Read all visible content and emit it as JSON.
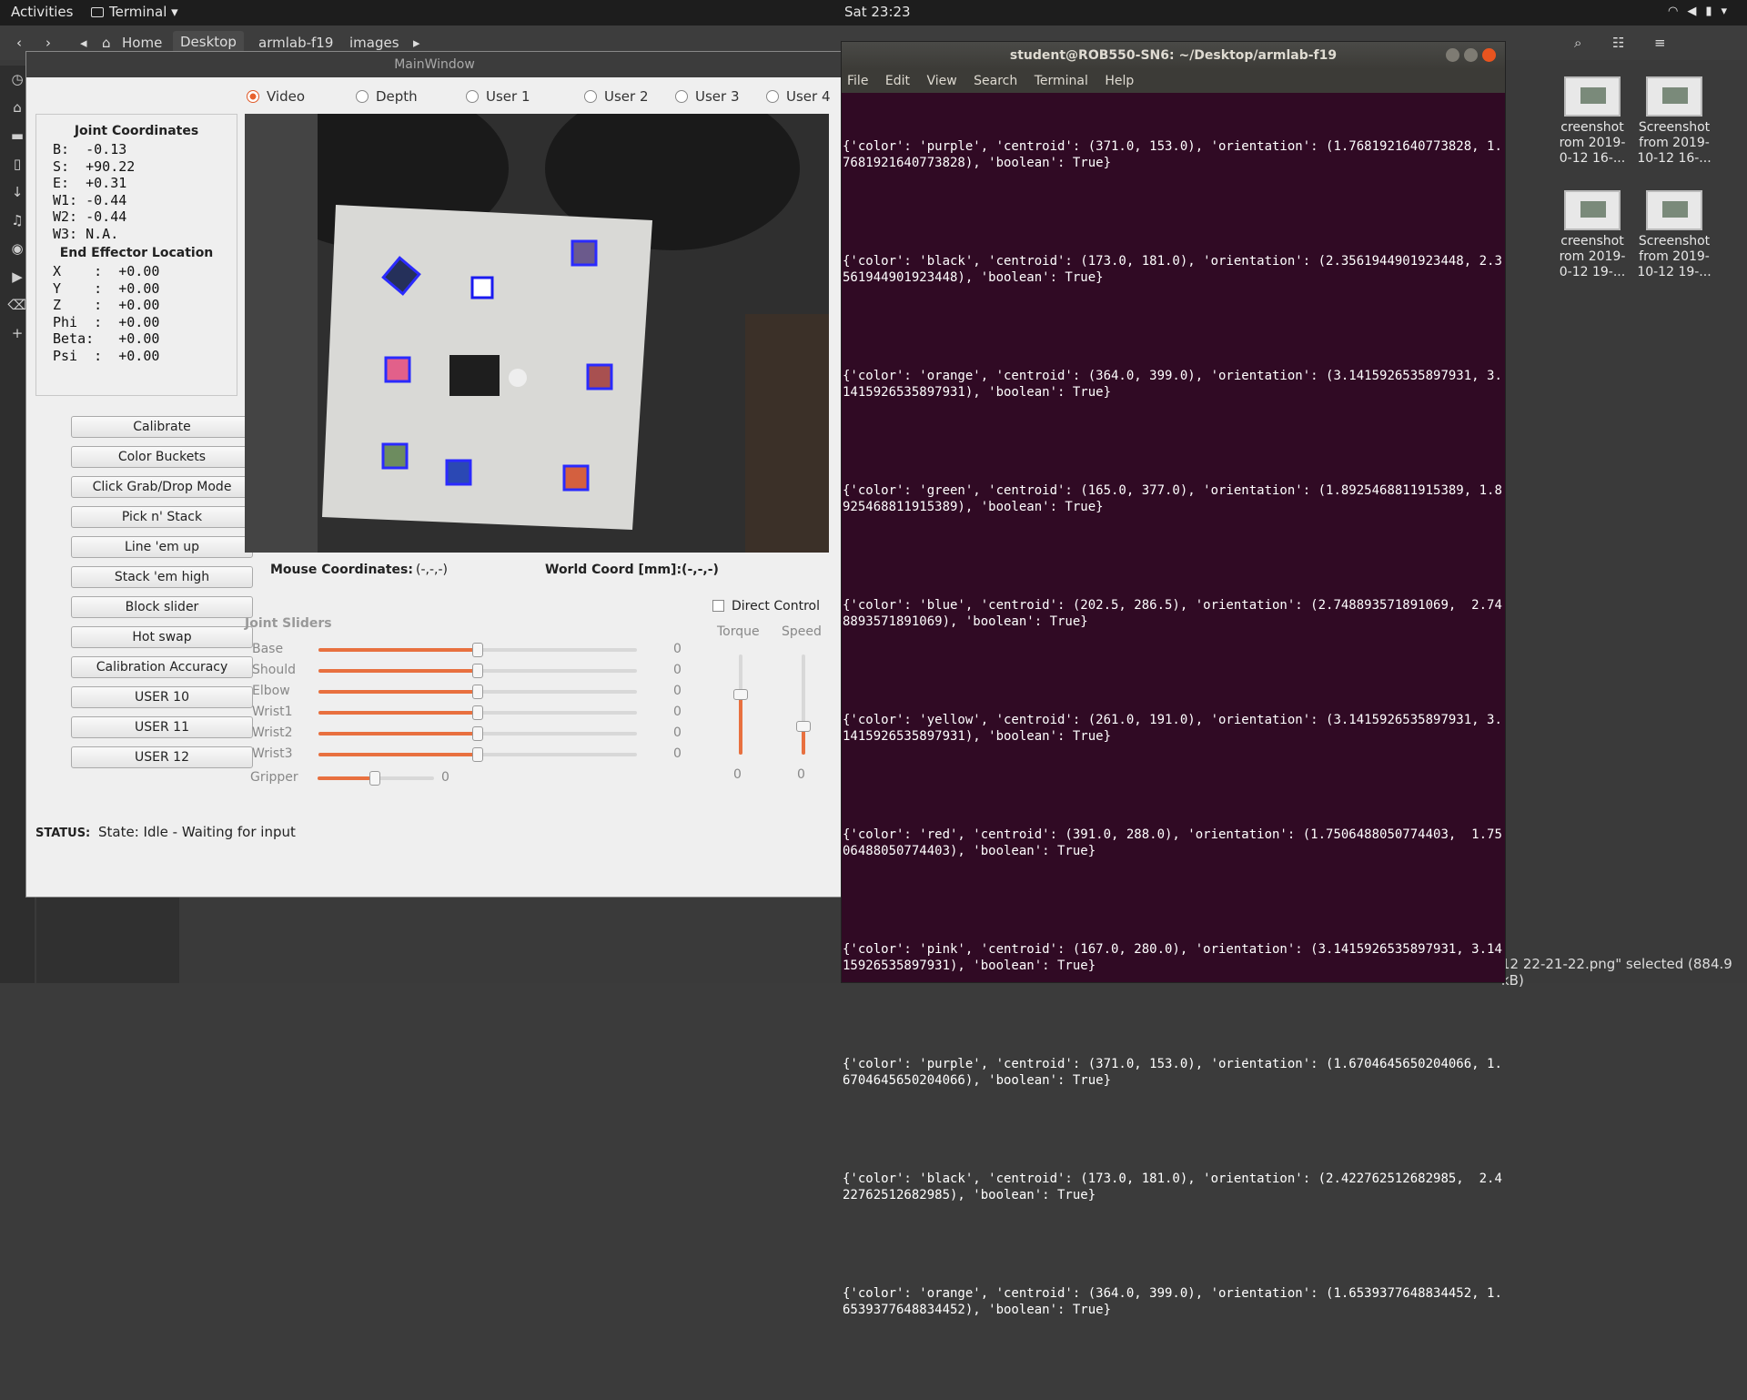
{
  "topbar": {
    "activities": "Activities",
    "app": "Terminal ▾",
    "clock": "Sat 23:23"
  },
  "filemanager": {
    "crumbs": [
      "Home",
      "Desktop",
      "armlab-f19",
      "images"
    ],
    "thumbs": [
      {
        "l1": "creenshot",
        "l2": "rom 2019-",
        "l3": "0-12 16-..."
      },
      {
        "l1": "Screenshot",
        "l2": "from 2019-",
        "l3": "10-12 16-..."
      },
      {
        "l1": "creenshot",
        "l2": "rom 2019-",
        "l3": "0-12 19-..."
      },
      {
        "l1": "Screenshot",
        "l2": "from 2019-",
        "l3": "10-12 19-..."
      }
    ],
    "status": "12 22-21-22.png\" selected (884.9 kB)"
  },
  "main": {
    "title": "MainWindow",
    "radios": [
      "Video",
      "Depth",
      "User 1",
      "User 2",
      "User 3",
      "User 4"
    ],
    "joint_title": "Joint Coordinates",
    "joints": [
      "B:  -0.13",
      "S:  +90.22",
      "E:  +0.31",
      "W1: -0.44",
      "W2: -0.44",
      "W3: N.A."
    ],
    "ee_title": "End Effector Location",
    "ee": [
      "X    :  +0.00",
      "Y    :  +0.00",
      "Z    :  +0.00",
      "Phi  :  +0.00",
      "Beta:   +0.00",
      "Psi  :  +0.00"
    ],
    "buttons": [
      "Calibrate",
      "Color Buckets",
      "Click Grab/Drop Mode",
      "Pick n' Stack",
      "Line 'em up",
      "Stack 'em high",
      "Block slider",
      "Hot swap",
      "Calibration Accuracy",
      "USER 10",
      "USER 11",
      "USER 12"
    ],
    "mouse_label": "Mouse Coordinates:",
    "mouse_value": "(-,-,-)",
    "world_label": "World Coord [mm]:(-,-,-)",
    "sliders_title": "Joint Sliders",
    "sliders": [
      {
        "name": "Base",
        "value": "0"
      },
      {
        "name": "Should",
        "value": "0"
      },
      {
        "name": "Elbow",
        "value": "0"
      },
      {
        "name": "Wrist1",
        "value": "0"
      },
      {
        "name": "Wrist2",
        "value": "0"
      },
      {
        "name": "Wrist3",
        "value": "0"
      }
    ],
    "gripper": {
      "name": "Gripper",
      "value": "0"
    },
    "direct_control": "Direct Control",
    "torque": {
      "label": "Torque",
      "value": "0"
    },
    "speed": {
      "label": "Speed",
      "value": "0"
    },
    "status_label": "STATUS:",
    "status_text": "State: Idle - Waiting for input"
  },
  "terminal": {
    "title": "student@ROB550-SN6: ~/Desktop/armlab-f19",
    "menu": [
      "File",
      "Edit",
      "View",
      "Search",
      "Terminal",
      "Help"
    ],
    "lines": [
      "{'color': 'purple', 'centroid': (371.0, 153.0), 'orientation': (1.7681921640773828, 1.7681921640773828), 'boolean': True}",
      "{'color': 'black', 'centroid': (173.0, 181.0), 'orientation': (2.3561944901923448, 2.3561944901923448), 'boolean': True}",
      "{'color': 'orange', 'centroid': (364.0, 399.0), 'orientation': (3.141592653589793​1, 3.1415926535897931), 'boolean': True}",
      "{'color': 'green', 'centroid': (165.0, 377.0), 'orientation': (1.8925468811915389, 1.8925468811915389), 'boolean': True}",
      "{'color': 'blue', 'centroid': (202.5, 286.5), 'orientation': (2.748893571891069,  2.748893571891069), 'boolean': True}",
      "{'color': 'yellow', 'centroid': (261.0, 191.0), 'orientation': (3.141592653589793​1, 3.1415926535897931), 'boolean': True}",
      "{'color': 'red', 'centroid': (391.0, 288.0), 'orientation': (1.7506488050774403,  1.7506488050774403), 'boolean': True}",
      "{'color': 'pink', 'centroid': (167.0, 280.0), 'orientation': (3.1415926535897931, 3.1415926535897931), 'boolean': True}",
      "{'color': 'purple', 'centroid': (371.0, 153.0), 'orientation': (1.670464565020406​6, 1.6704645650204066), 'boolean': True}",
      "{'color': 'black', 'centroid': (173.0, 181.0), 'orientation': (2.422762512682985,  2.422762512682985), 'boolean': True}",
      "{'color': 'orange', 'centroid': (364.0, 399.0), 'orientation': (1.653937764883445​2, 1.6539377648834452), 'boolean': True}"
    ]
  },
  "colors": {
    "accent": "#e8703f",
    "terminal_bg": "#300a24"
  }
}
